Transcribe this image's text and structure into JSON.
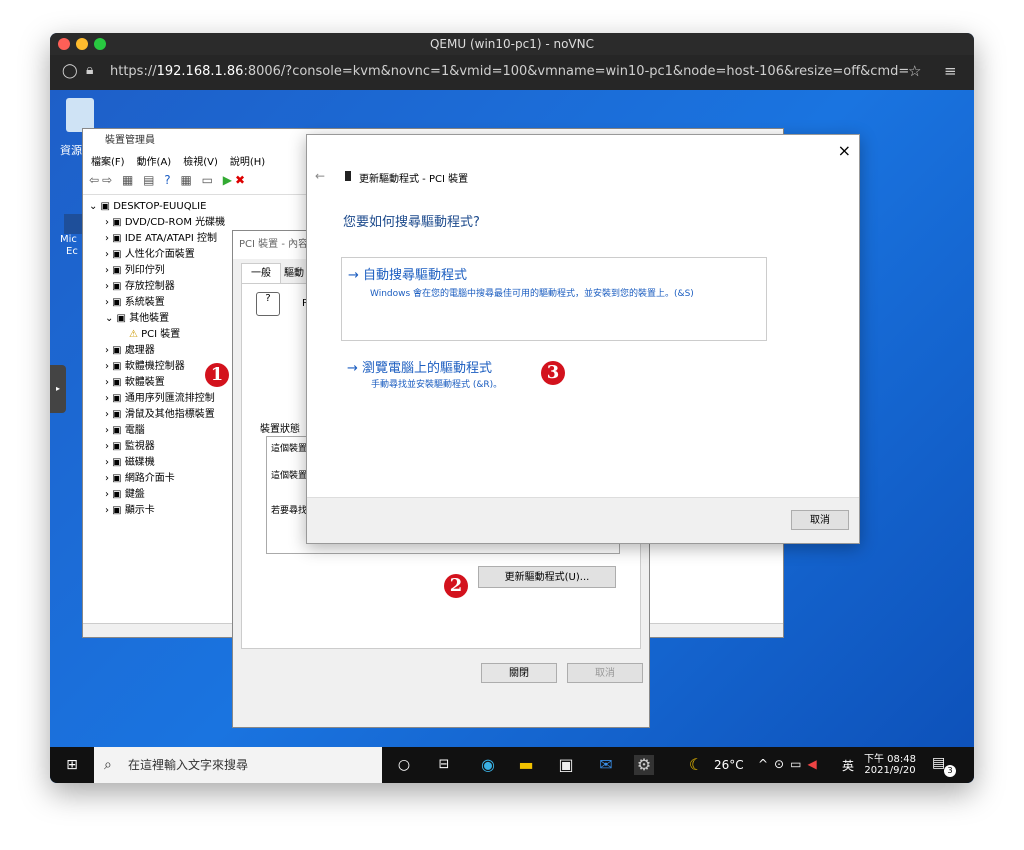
{
  "browser": {
    "title": "QEMU (win10-pc1) - noVNC",
    "url_prefix": "https://",
    "url_host": "192.168.1.86",
    "url_rest": ":8006/?console=kvm&novnc=1&vmid=100&vmname=win10-pc1&node=host-106&resize=off&cmd="
  },
  "desktop": {
    "icon1_label": "資源",
    "icon2_label": "Mic",
    "icon2_label2": "Ec"
  },
  "devmgr": {
    "title": "裝置管理員",
    "menu": [
      "檔案(F)",
      "動作(A)",
      "檢視(V)",
      "說明(H)"
    ],
    "tree": [
      "DESKTOP-EUUQLIE",
      "DVD/CD-ROM 光碟機",
      "IDE ATA/ATAPI 控制",
      "人性化介面裝置",
      "列印佇列",
      "存放控制器",
      "系統裝置",
      "其他裝置",
      "PCI 裝置",
      "處理器",
      "軟體機控制器",
      "軟體裝置",
      "通用序列匯流排控制",
      "滑鼠及其他指標裝置",
      "電腦",
      "監視器",
      "磁碟機",
      "網路介面卡",
      "鍵盤",
      "顯示卡"
    ]
  },
  "props": {
    "title": "PCI 裝置 - 內容",
    "tab1": "一般",
    "tab2": "驅動",
    "status_label": "裝置狀態",
    "line1": "這個裝置",
    "line2": "這個裝置",
    "line3": "若要尋找",
    "update_btn": "更新驅動程式(U)...",
    "close_btn": "關閉",
    "cancel_btn": "取消",
    "p": "P"
  },
  "wizard": {
    "header": "更新驅動程式 - PCI 裝置",
    "question": "您要如何搜尋驅動程式?",
    "opt1_title": "自動搜尋驅動程式",
    "opt1_desc": "Windows 會在您的電腦中搜尋最佳可用的驅動程式，並安裝到您的裝置上。(&S)",
    "opt2_title": "瀏覽電腦上的驅動程式",
    "opt2_desc": "手動尋找並安裝驅動程式 (&R)。",
    "cancel": "取消",
    "close": "×",
    "back": "←",
    "arrow": "→"
  },
  "badges": {
    "b1": "1",
    "b2": "2",
    "b3": "3"
  },
  "taskbar": {
    "search": "在這裡輸入文字來搜尋",
    "weather": "26°C",
    "ime": "英",
    "time": "下午 08:48",
    "date": "2021/9/20",
    "notif": "3"
  }
}
